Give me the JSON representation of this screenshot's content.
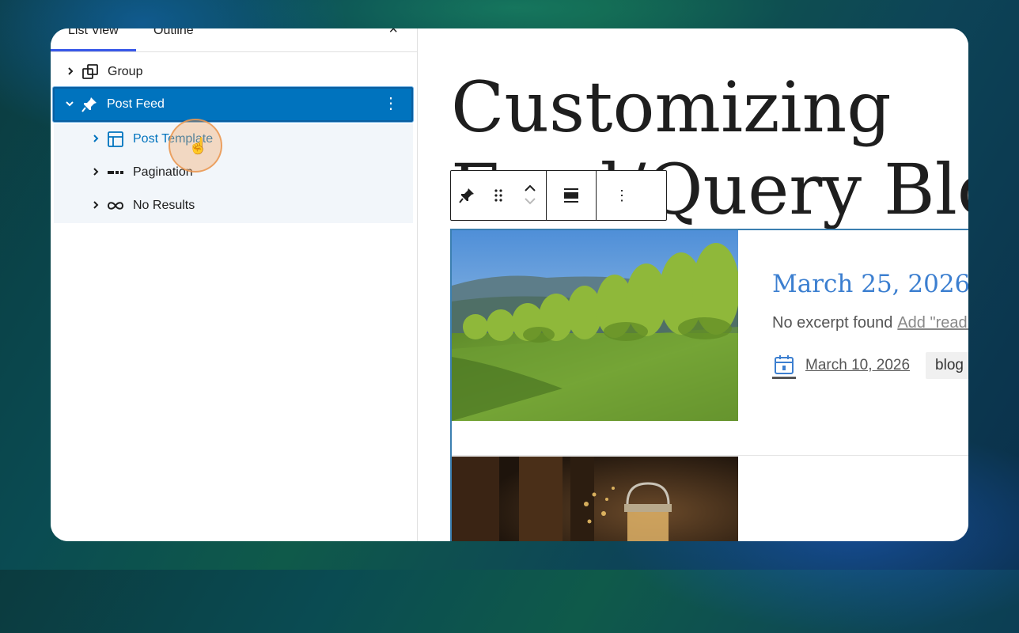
{
  "sidebar": {
    "tabs": [
      {
        "label": "List View"
      },
      {
        "label": "Outline"
      }
    ],
    "close_label": "×",
    "tree": {
      "group": {
        "label": "Group",
        "icon": "group-icon"
      },
      "post_feed": {
        "label": "Post Feed",
        "icon": "pin-icon"
      },
      "post_template": {
        "label": "Post Template",
        "icon": "layout-icon"
      },
      "pagination": {
        "label": "Pagination",
        "icon": "pagination-icon"
      },
      "no_results": {
        "label": "No Results",
        "icon": "loop-icon"
      }
    }
  },
  "editor": {
    "title_line1": "Customizing",
    "title_line2": "Feed/Query Block",
    "toolbar": {
      "icons": [
        "pin-icon",
        "drag-handle-icon",
        "move-up-icon",
        "move-down-icon",
        "align-icon",
        "more-options-icon"
      ]
    },
    "post1": {
      "title": "March 25, 2026",
      "excerpt": "No excerpt found",
      "excerpt_link": "Add \"read more\" link text",
      "date": "March 10, 2026",
      "tag": "blog"
    }
  },
  "colors": {
    "accent": "#0073be",
    "link": "#3c7fd0",
    "selected_row": "#0073be"
  }
}
